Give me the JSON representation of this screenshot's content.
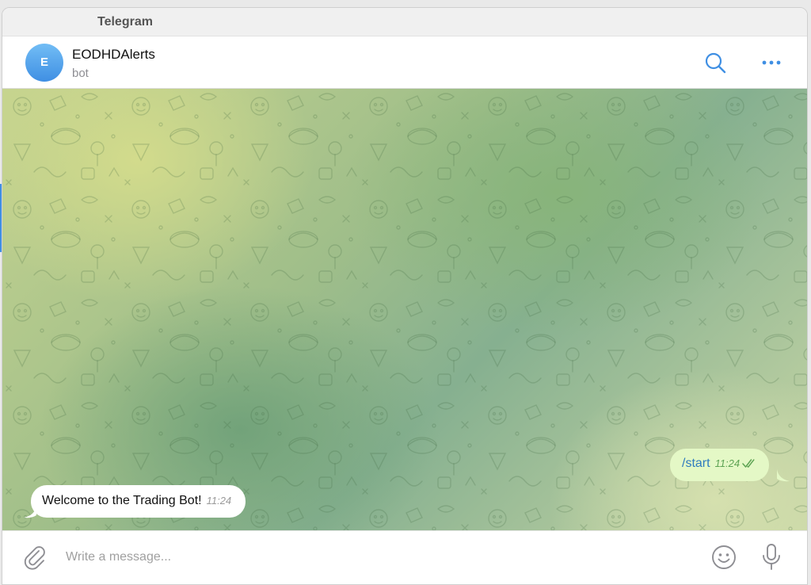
{
  "window": {
    "title": "Telegram"
  },
  "chat": {
    "avatar_letter": "E",
    "name": "EODHDAlerts",
    "status": "bot"
  },
  "header_icons": [
    "search-icon",
    "more-icon"
  ],
  "messages": [
    {
      "direction": "outgoing",
      "text": "/start",
      "time": "11:24",
      "status": "read"
    },
    {
      "direction": "incoming",
      "text": "Welcome to the Trading Bot!",
      "time": "11:24"
    }
  ],
  "composer": {
    "placeholder": "Write a message...",
    "value": ""
  },
  "colors": {
    "accent": "#3f8fe3",
    "outgoing_bubble": "#e4f8c6",
    "outgoing_text": "#2e7bbf",
    "read_check": "#5ea454"
  }
}
